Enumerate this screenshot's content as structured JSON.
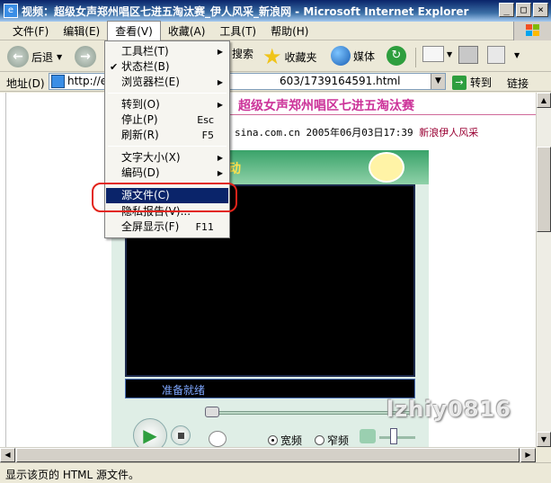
{
  "window": {
    "title": "视频：超级女声郑州唱区七进五淘汰赛_伊人风采_新浪网 - Microsoft Internet Explorer",
    "minimize": "_",
    "maximize": "□",
    "close": "×"
  },
  "menubar": {
    "items": [
      {
        "label": "文件(F)"
      },
      {
        "label": "编辑(E)"
      },
      {
        "label": "查看(V)"
      },
      {
        "label": "收藏(A)"
      },
      {
        "label": "工具(T)"
      },
      {
        "label": "帮助(H)"
      }
    ]
  },
  "toolbar": {
    "back_label": "后退",
    "search_label": "搜索",
    "favorites_label": "收藏夹",
    "media_label": "媒体"
  },
  "address": {
    "label": "地址(D)",
    "url_start": "http://e",
    "url_end": "603/1739164591.html",
    "go_label": "转到",
    "links_label": "链接"
  },
  "view_menu": {
    "items": [
      {
        "label": "工具栏(T)",
        "shortcut": "",
        "submenu": true,
        "checked": false
      },
      {
        "label": "状态栏(B)",
        "shortcut": "",
        "submenu": false,
        "checked": true
      },
      {
        "label": "浏览器栏(E)",
        "shortcut": "",
        "submenu": true,
        "checked": false
      },
      {
        "label": "转到(O)",
        "shortcut": "",
        "submenu": true,
        "checked": false
      },
      {
        "label": "停止(P)",
        "shortcut": "Esc",
        "submenu": false,
        "checked": false
      },
      {
        "label": "刷新(R)",
        "shortcut": "F5",
        "submenu": false,
        "checked": false
      },
      {
        "label": "文字大小(X)",
        "shortcut": "",
        "submenu": true,
        "checked": false
      },
      {
        "label": "编码(D)",
        "shortcut": "",
        "submenu": true,
        "checked": false
      },
      {
        "label": "源文件(C)",
        "shortcut": "",
        "submenu": false,
        "checked": false,
        "highlighted": true
      },
      {
        "label": "隐私报告(V)...",
        "shortcut": "",
        "submenu": false,
        "checked": false
      },
      {
        "label": "全屏显示(F)",
        "shortcut": "F11",
        "submenu": false,
        "checked": false
      }
    ]
  },
  "page": {
    "headline": "超级女声郑州唱区七进五淘汰赛",
    "byline_source": "sina.com.cn 2005年06月03日17:39",
    "byline_channel": "新浪伊人风采",
    "player_title": "动",
    "player_status": "准备就绪",
    "radio_wide": "宽频",
    "radio_narrow": "窄频",
    "watermark": "lzhiy0816"
  },
  "statusbar": {
    "text": "显示该页的 HTML 源文件。"
  },
  "colors": {
    "highlight": "#0a246a",
    "annotation_circle": "#e2231a",
    "headline": "#cc3399"
  }
}
